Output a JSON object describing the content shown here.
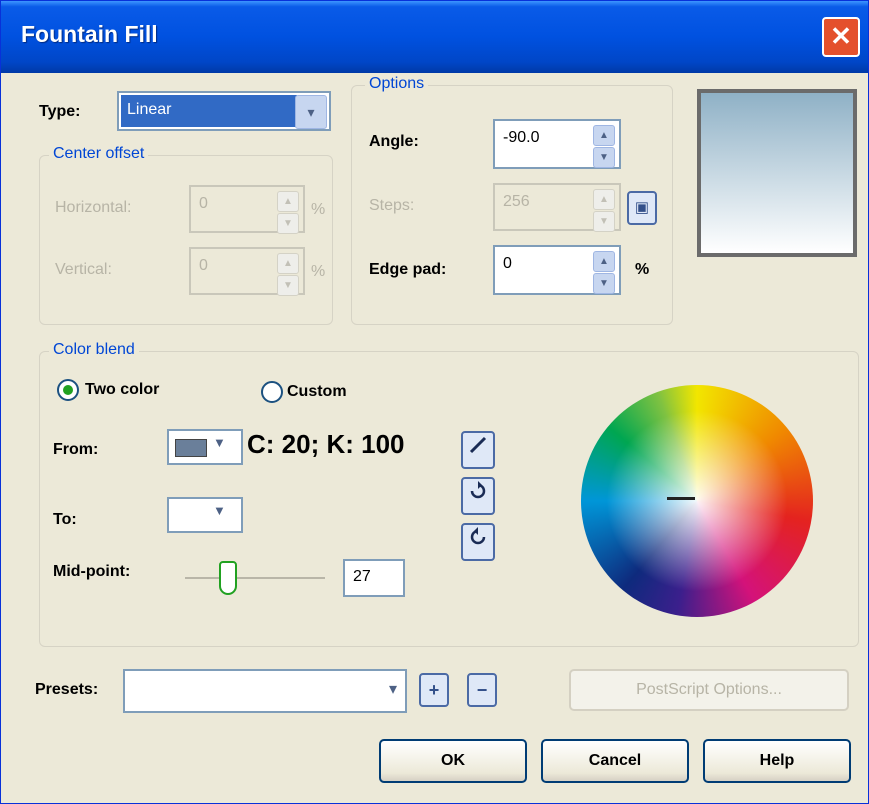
{
  "window": {
    "title": "Fountain Fill",
    "close_glyph": "✕"
  },
  "type": {
    "label": "Type:",
    "value": "Linear",
    "arrow": "▾"
  },
  "center_offset": {
    "legend": "Center offset",
    "horizontal_label": "Horizontal:",
    "horizontal_value": "0",
    "horizontal_unit": "%",
    "vertical_label": "Vertical:",
    "vertical_value": "0",
    "vertical_unit": "%"
  },
  "options": {
    "legend": "Options",
    "angle_label": "Angle:",
    "angle_value": "-90.0",
    "steps_label": "Steps:",
    "steps_value": "256",
    "edge_pad_label": "Edge pad:",
    "edge_pad_value": "0",
    "edge_pad_unit": "%"
  },
  "color_blend": {
    "legend": "Color blend",
    "two_color_label": "Two color",
    "custom_label": "Custom",
    "selected": "two_color",
    "from_label": "From:",
    "from_color_text": "C: 20; K: 100",
    "to_label": "To:",
    "midpoint_label": "Mid-point:",
    "midpoint_value": "27",
    "midpoint_fraction": 0.27,
    "tool_icons": [
      "eyedropper-icon",
      "clockwise-blend-icon",
      "counterclockwise-blend-icon"
    ]
  },
  "presets": {
    "label": "Presets:",
    "value": "",
    "arrow": "▾",
    "add_glyph": "+",
    "remove_glyph": "−"
  },
  "buttons": {
    "postscript": "PostScript Options...",
    "ok": "OK",
    "cancel": "Cancel",
    "help": "Help"
  },
  "colors": {
    "accent": "#0046d5",
    "from_swatch": "#6a7f9a",
    "to_swatch": "#ffffff",
    "preview_top": "#8fb1c6",
    "preview_bottom": "#ffffff"
  }
}
